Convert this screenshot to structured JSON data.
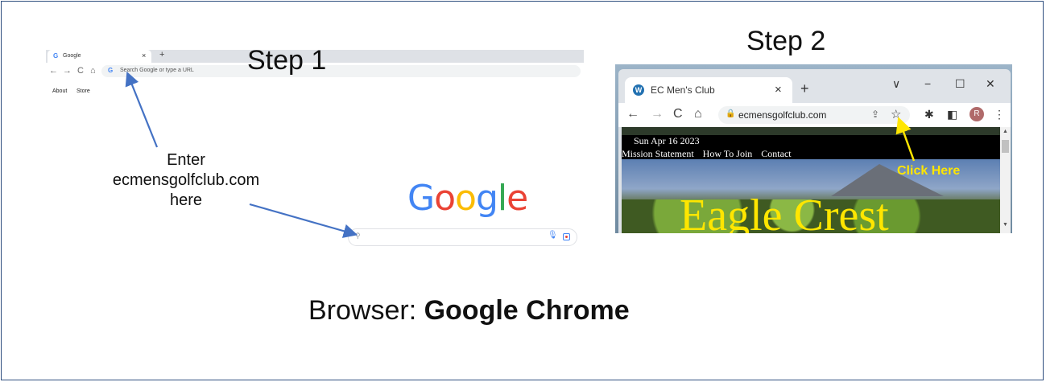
{
  "step1": {
    "label": "Step 1",
    "tab_title": "Google",
    "tab_close": "×",
    "new_tab": "+",
    "nav": {
      "back": "←",
      "forward": "→",
      "reload": "C",
      "home": "⌂"
    },
    "omnibox_placeholder": "Search Google or type a URL",
    "links": [
      "About",
      "Store"
    ],
    "google_logo": [
      "G",
      "o",
      "o",
      "g",
      "l",
      "e"
    ],
    "logo_colors": [
      "#4285f4",
      "#ea4335",
      "#fbbc05",
      "#4285f4",
      "#34a853",
      "#ea4335"
    ],
    "instruction_lines": [
      "Enter",
      "ecmensgolfclub.com",
      "here"
    ]
  },
  "step2": {
    "label": "Step 2",
    "tab_title": "EC Men's Club",
    "tab_close": "×",
    "new_tab": "+",
    "window_controls": {
      "collapse": "∨",
      "minimize": "−",
      "maximize": "☐",
      "close": "✕"
    },
    "nav": {
      "back": "←",
      "forward": "→",
      "reload": "C",
      "home": "⌂"
    },
    "url": "ecmensgolfclub.com",
    "avatar_initial": "R",
    "page": {
      "date": "Sun Apr 16 2023",
      "menu": [
        "Mission Statement",
        "How To Join",
        "Contact"
      ],
      "title": "Eagle Crest"
    },
    "callout": "Click Here",
    "callout_color": "#ffe600"
  },
  "footer": {
    "prefix": "Browser: ",
    "browser_name": "Google Chrome"
  },
  "colors": {
    "arrow_blue": "#4472c4",
    "border": "#2f4f7f"
  }
}
